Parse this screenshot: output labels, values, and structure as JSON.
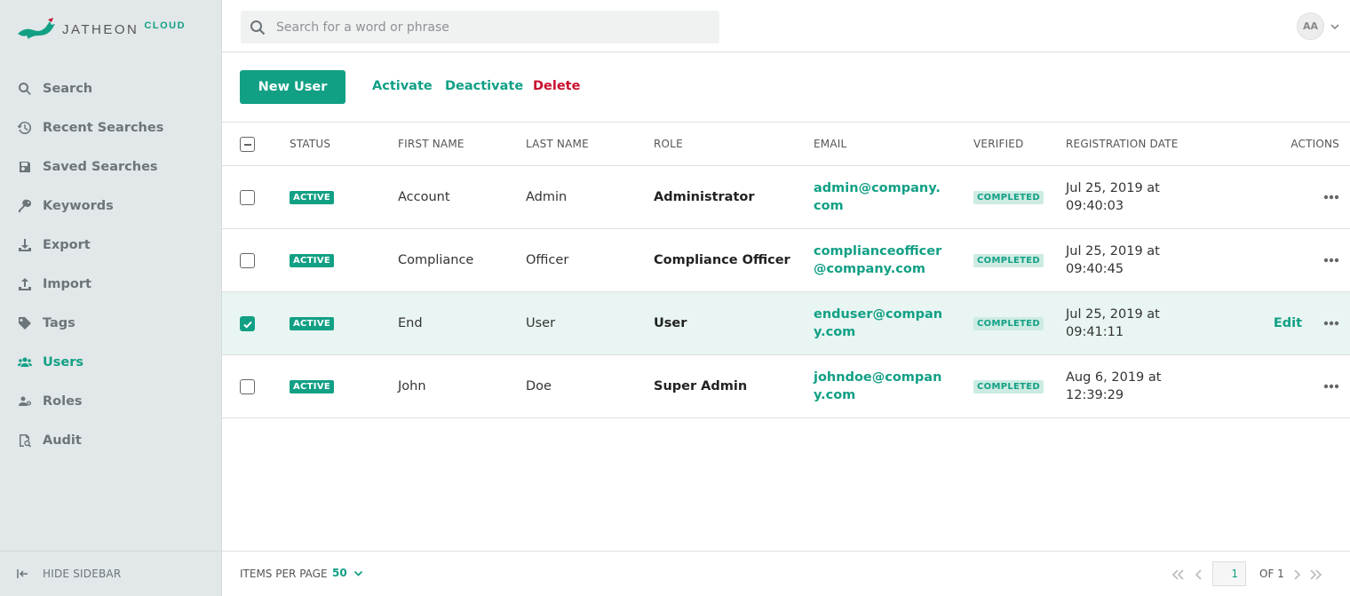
{
  "brand": {
    "name": "JATHEON",
    "suffix": "CLOUD",
    "accent": "#12a085",
    "danger": "#c8102e"
  },
  "sidebar": {
    "items": [
      {
        "label": "Search",
        "icon": "search-icon",
        "active": false
      },
      {
        "label": "Recent Searches",
        "icon": "history-icon",
        "active": false
      },
      {
        "label": "Saved Searches",
        "icon": "save-icon",
        "active": false
      },
      {
        "label": "Keywords",
        "icon": "key-icon",
        "active": false
      },
      {
        "label": "Export",
        "icon": "export-icon",
        "active": false
      },
      {
        "label": "Import",
        "icon": "import-icon",
        "active": false
      },
      {
        "label": "Tags",
        "icon": "tag-icon",
        "active": false
      },
      {
        "label": "Users",
        "icon": "users-icon",
        "active": true
      },
      {
        "label": "Roles",
        "icon": "roles-icon",
        "active": false
      },
      {
        "label": "Audit",
        "icon": "audit-icon",
        "active": false
      }
    ],
    "hide_label": "HIDE SIDEBAR"
  },
  "header": {
    "search_placeholder": "Search for a word or phrase",
    "avatar_initials": "AA"
  },
  "toolbar": {
    "new_user": "New User",
    "activate": "Activate",
    "deactivate": "Deactivate",
    "delete": "Delete"
  },
  "table": {
    "columns": {
      "status": "STATUS",
      "first_name": "FIRST NAME",
      "last_name": "LAST NAME",
      "role": "ROLE",
      "email": "EMAIL",
      "verified": "VERIFIED",
      "registration_date": "REGISTRATION DATE",
      "actions": "ACTIONS"
    },
    "rows": [
      {
        "checked": false,
        "status": "ACTIVE",
        "first_name": "Account",
        "last_name": "Admin",
        "role": "Administrator",
        "email": "admin@company.com",
        "verified": "COMPLETED",
        "date": "Jul 25, 2019 at 09:40:03",
        "edit": ""
      },
      {
        "checked": false,
        "status": "ACTIVE",
        "first_name": "Compliance",
        "last_name": "Officer",
        "role": "Compliance Officer",
        "email": "complianceofficer@company.com",
        "verified": "COMPLETED",
        "date": "Jul 25, 2019 at 09:40:45",
        "edit": ""
      },
      {
        "checked": true,
        "status": "ACTIVE",
        "first_name": "End",
        "last_name": "User",
        "role": "User",
        "email": "enduser@company.com",
        "verified": "COMPLETED",
        "date": "Jul 25, 2019 at 09:41:11",
        "edit": "Edit"
      },
      {
        "checked": false,
        "status": "ACTIVE",
        "first_name": "John",
        "last_name": "Doe",
        "role": "Super Admin",
        "email": "johndoe@company.com",
        "verified": "COMPLETED",
        "date": "Aug 6, 2019 at 12:39:29",
        "edit": ""
      }
    ]
  },
  "footer": {
    "items_per_page_label": "ITEMS PER PAGE",
    "items_per_page_value": "50",
    "current_page": "1",
    "of_label": "OF 1"
  }
}
